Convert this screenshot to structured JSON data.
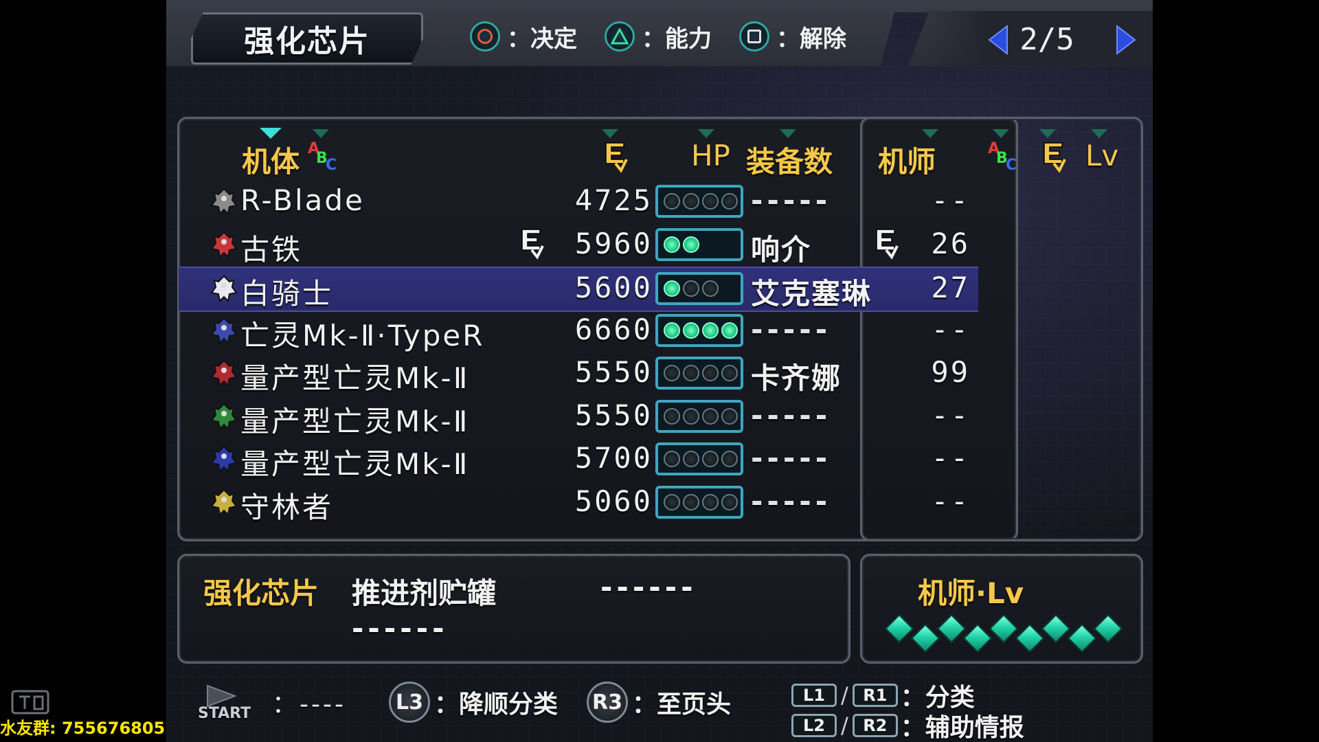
{
  "header": {
    "title": "强化芯片",
    "hints": [
      {
        "symbol": "circle",
        "label": "：决定",
        "color": "#e85a3a"
      },
      {
        "symbol": "triangle",
        "label": "：能力",
        "color": "#3ae0a0"
      },
      {
        "symbol": "square",
        "label": "：解除",
        "color": "#e0e0e0"
      }
    ],
    "page": "2/5"
  },
  "table": {
    "col_unit": "机体",
    "col_hp": "HP",
    "col_slots": "装备数",
    "col_pilot": "机师",
    "col_lv": "Lv",
    "abc": {
      "a": "A",
      "b": "B",
      "c": "C"
    },
    "rows": [
      {
        "unit": "R-Blade",
        "hp": "4725",
        "slots_filled": 0,
        "slots_total": 4,
        "pilot": "-----",
        "lv": "--",
        "unit_ace": false,
        "pilot_ace": false,
        "color": "#8a8a8a",
        "selected": false
      },
      {
        "unit": "古铁",
        "hp": "5960",
        "slots_filled": 2,
        "slots_total": 2,
        "pilot": "响介",
        "lv": "26",
        "unit_ace": true,
        "pilot_ace": true,
        "color": "#c8383a",
        "selected": false
      },
      {
        "unit": "白骑士",
        "hp": "5600",
        "slots_filled": 1,
        "slots_total": 3,
        "pilot": "艾克塞琳",
        "lv": "27",
        "unit_ace": false,
        "pilot_ace": false,
        "color": "#e8e8f0",
        "selected": true
      },
      {
        "unit": "亡灵Mk-Ⅱ·TypeR",
        "hp": "6660",
        "slots_filled": 4,
        "slots_total": 4,
        "pilot": "-----",
        "lv": "--",
        "unit_ace": false,
        "pilot_ace": false,
        "color": "#3a4ab0",
        "selected": false
      },
      {
        "unit": "量产型亡灵Mk-Ⅱ",
        "hp": "5550",
        "slots_filled": 0,
        "slots_total": 4,
        "pilot": "卡齐娜",
        "lv": "99",
        "unit_ace": false,
        "pilot_ace": false,
        "color": "#b02a30",
        "selected": false
      },
      {
        "unit": "量产型亡灵Mk-Ⅱ",
        "hp": "5550",
        "slots_filled": 0,
        "slots_total": 4,
        "pilot": "-----",
        "lv": "--",
        "unit_ace": false,
        "pilot_ace": false,
        "color": "#2e8a3a",
        "selected": false
      },
      {
        "unit": "量产型亡灵Mk-Ⅱ",
        "hp": "5700",
        "slots_filled": 0,
        "slots_total": 4,
        "pilot": "-----",
        "lv": "--",
        "unit_ace": false,
        "pilot_ace": false,
        "color": "#2a3aa8",
        "selected": false
      },
      {
        "unit": "守林者",
        "hp": "5060",
        "slots_filled": 0,
        "slots_total": 4,
        "pilot": "-----",
        "lv": "--",
        "unit_ace": false,
        "pilot_ace": false,
        "color": "#c8b040",
        "selected": false
      }
    ]
  },
  "info": {
    "label": "强化芯片",
    "chip1": "推进剂贮罐",
    "chip2": "------",
    "chip3": "------"
  },
  "pilot_lv": {
    "label": "机师·Lv",
    "gems": 9
  },
  "footer": {
    "start_label": "START",
    "start_value": "：----",
    "l3_label": "L3",
    "l3_text": "：降顺分类",
    "r3_label": "R3",
    "r3_text": "：至页头",
    "l1": "L1",
    "r1": "R1",
    "l1r1_text": "：分类",
    "l2": "L2",
    "r2": "R2",
    "l2r2_text": "：辅助情报"
  },
  "watermark": {
    "text": "水友群: 755676805"
  }
}
